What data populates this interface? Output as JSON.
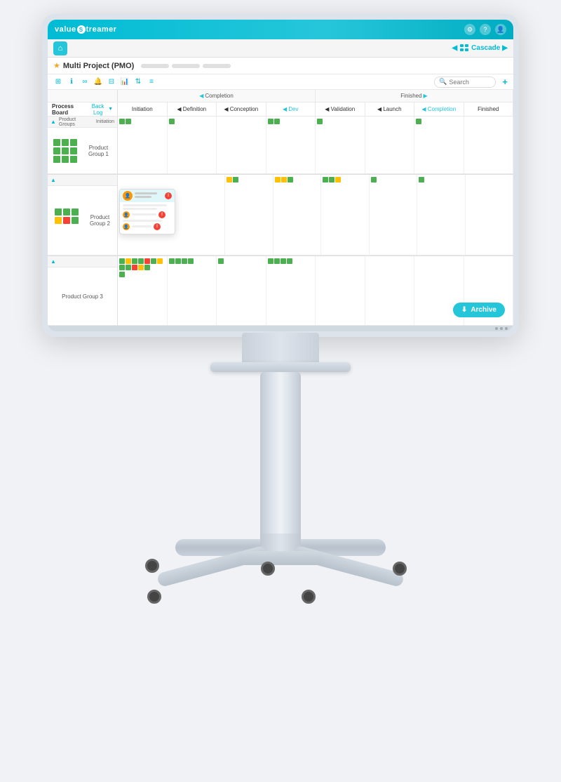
{
  "app": {
    "logo": "valueStreamer",
    "logo_s": "S",
    "icons": [
      "⚙",
      "?",
      "👤"
    ]
  },
  "nav": {
    "cascade_label": "Cascade",
    "home_icon": "⌂"
  },
  "project": {
    "title": "Multi Project (PMO)",
    "star": "★"
  },
  "toolbar": {
    "search_placeholder": "Search",
    "add_label": "+"
  },
  "phases": [
    {
      "label": "Back Log",
      "complete": false
    },
    {
      "label": "Product Groups",
      "complete": false
    },
    {
      "label": "Initiation",
      "complete": false
    },
    {
      "label": "Definition",
      "complete": false
    },
    {
      "label": "Conception",
      "complete": false
    },
    {
      "label": "Dev",
      "complete": true
    },
    {
      "label": "Validation",
      "complete": true
    },
    {
      "label": "Launch",
      "complete": true
    },
    {
      "label": "Completion",
      "complete": true
    },
    {
      "label": "Finished",
      "complete": true
    }
  ],
  "board": {
    "title": "Process Board",
    "back_log": "Back Log"
  },
  "groups": [
    {
      "label": "Product Group 1"
    },
    {
      "label": "Product Group 2"
    },
    {
      "label": "Product Group 3"
    }
  ],
  "archive_button": "Archive"
}
